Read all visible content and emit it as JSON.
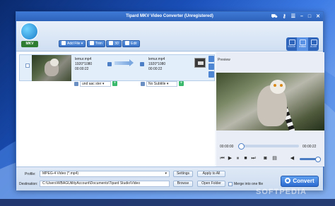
{
  "window": {
    "title": "Tipard MKV Video Converter (Unregistered)"
  },
  "titlebar_controls": [
    "cart-icon",
    "key-icon",
    "menu-icon",
    "minimize-icon",
    "maximize-icon",
    "close-icon"
  ],
  "logo_text": "MKV",
  "toolbar": {
    "add_file": "Add File",
    "trim": "Trim",
    "threed": "3D",
    "edit": "Edit"
  },
  "modes": [
    "Movie",
    "Initial",
    "Audit"
  ],
  "file": {
    "source_name": "lemur.mp4",
    "source_res": "1920*1080",
    "source_dur": "00:00:22",
    "target_name": "lemur.mp4",
    "target_res": "1920*1080",
    "target_dur": "00:00:22",
    "audio_track": "und aac ster",
    "subtitle": "No Subtitle"
  },
  "preview": {
    "label": "Preview",
    "time_current": "00:00:00",
    "time_total": "00:00:22",
    "progress": 0
  },
  "bottom": {
    "profile_label": "Profile:",
    "profile_value": "MPEG-4 Video (*.mp4)",
    "settings": "Settings",
    "apply_all": "Apply to All",
    "destination_label": "Destination:",
    "destination_value": "C:\\Users\\WBAGUtilityAccount\\Documents\\Tipard Studio\\Video",
    "browse": "Browse",
    "open_folder": "Open Folder",
    "merge": "Merge into one file",
    "convert": "Convert"
  },
  "watermark": "SOFTPEDIA"
}
